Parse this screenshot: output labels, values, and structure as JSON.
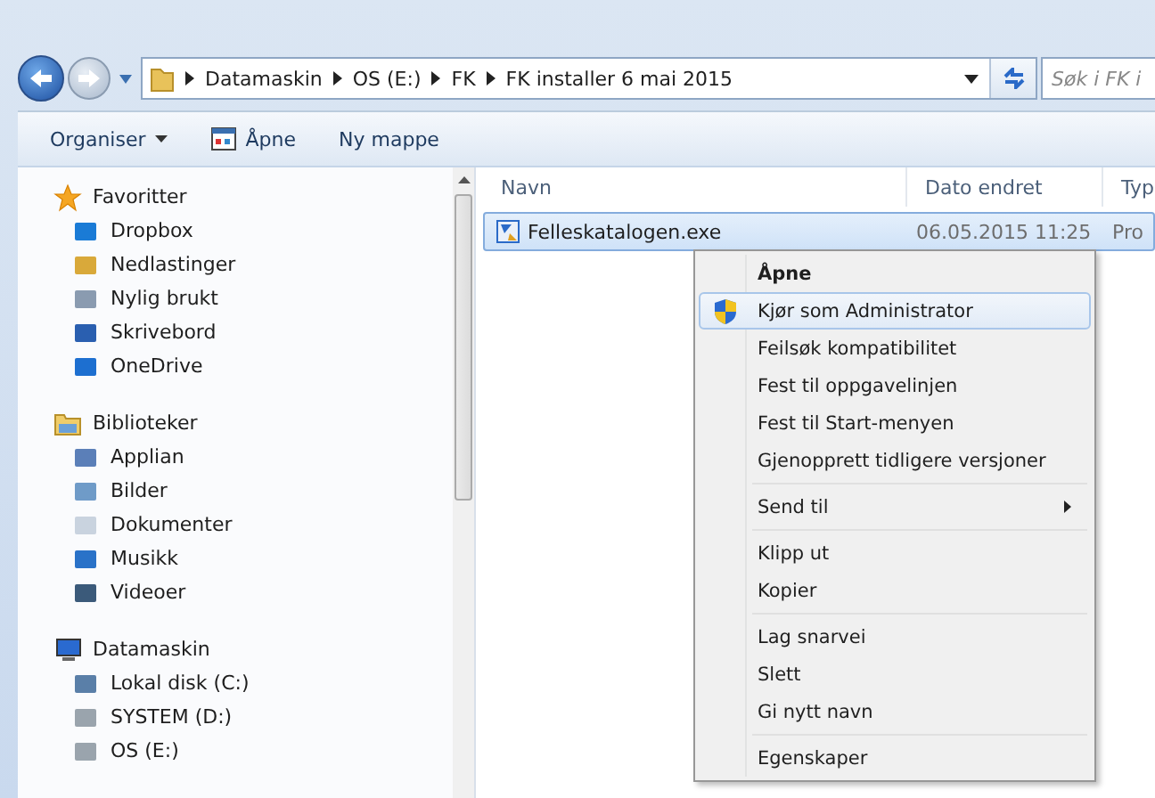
{
  "address_bar": {
    "path": [
      "Datamaskin",
      "OS (E:)",
      "FK",
      "FK installer 6 mai 2015"
    ]
  },
  "search": {
    "placeholder": "Søk i FK i"
  },
  "toolbar": {
    "organise": "Organiser",
    "open": "Åpne",
    "new_folder": "Ny mappe"
  },
  "sidebar": {
    "groups": [
      {
        "label": "Favoritter",
        "children": [
          {
            "label": "Dropbox"
          },
          {
            "label": "Nedlastinger"
          },
          {
            "label": "Nylig brukt"
          },
          {
            "label": "Skrivebord"
          },
          {
            "label": "OneDrive"
          }
        ]
      },
      {
        "label": "Biblioteker",
        "children": [
          {
            "label": "Applian"
          },
          {
            "label": "Bilder"
          },
          {
            "label": "Dokumenter"
          },
          {
            "label": "Musikk"
          },
          {
            "label": "Videoer"
          }
        ]
      },
      {
        "label": "Datamaskin",
        "children": [
          {
            "label": "Lokal disk (C:)"
          },
          {
            "label": "SYSTEM (D:)"
          },
          {
            "label": "OS (E:)"
          }
        ]
      }
    ]
  },
  "table": {
    "columns": [
      "Navn",
      "Dato endret",
      "Typ"
    ],
    "rows": [
      {
        "name": "Felleskatalogen.exe",
        "date": "06.05.2015 11:25",
        "type": "Pro",
        "selected": true
      }
    ]
  },
  "context_menu": {
    "items": [
      {
        "kind": "default",
        "label": "Åpne",
        "selected": false
      },
      {
        "kind": "admin",
        "label": "Kjør som Administrator",
        "selected": true
      },
      {
        "kind": "plain",
        "label": "Feilsøk kompatibilitet",
        "selected": false
      },
      {
        "kind": "plain",
        "label": "Fest til oppgavelinjen",
        "selected": false
      },
      {
        "kind": "plain",
        "label": "Fest til Start-menyen",
        "selected": false
      },
      {
        "kind": "plain",
        "label": "Gjenopprett tidligere versjoner",
        "selected": false
      },
      {
        "kind": "separator"
      },
      {
        "kind": "submenu",
        "label": "Send til",
        "selected": false
      },
      {
        "kind": "separator"
      },
      {
        "kind": "plain",
        "label": "Klipp ut",
        "selected": false
      },
      {
        "kind": "plain",
        "label": "Kopier",
        "selected": false
      },
      {
        "kind": "separator"
      },
      {
        "kind": "plain",
        "label": "Lag snarvei",
        "selected": false
      },
      {
        "kind": "plain",
        "label": "Slett",
        "selected": false
      },
      {
        "kind": "plain",
        "label": "Gi nytt navn",
        "selected": false
      },
      {
        "kind": "separator"
      },
      {
        "kind": "plain",
        "label": "Egenskaper",
        "selected": false
      }
    ]
  }
}
